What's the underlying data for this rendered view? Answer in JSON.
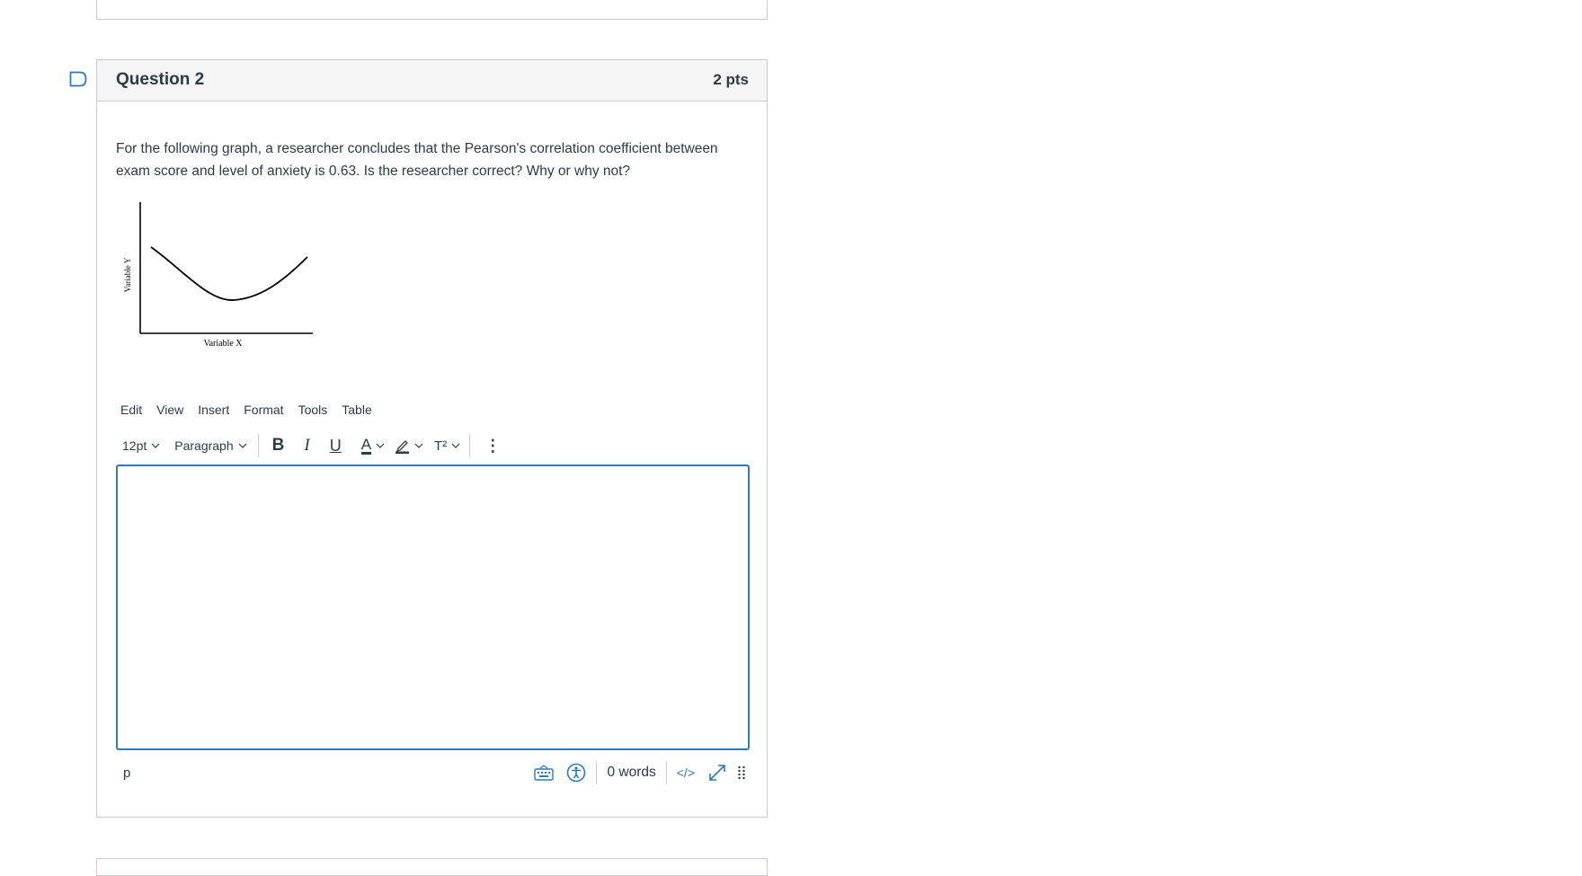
{
  "question": {
    "title": "Question 2",
    "points": "2 pts",
    "text": "For the following graph, a researcher concludes that the Pearson's correlation coefficient between exam score and level of anxiety is 0.63. Is the researcher correct? Why or why not?",
    "graph": {
      "x_label": "Variable X",
      "y_label": "Variable Y",
      "curve": "u-shaped"
    }
  },
  "editor": {
    "menu": [
      "Edit",
      "View",
      "Insert",
      "Format",
      "Tools",
      "Table"
    ],
    "toolbar": {
      "font_size": "12pt",
      "block_format": "Paragraph",
      "bold": "B",
      "italic": "I",
      "underline": "U",
      "text_color": "A",
      "superscript": "T²",
      "more": "⋮"
    },
    "content": "",
    "status": {
      "path": "p",
      "word_count": "0 words",
      "html_toggle": "</>"
    }
  },
  "colors": {
    "accent": "#2b7abc",
    "header_bg": "#f5f5f5",
    "border": "#c7cdd1",
    "text": "#2d3b45"
  }
}
